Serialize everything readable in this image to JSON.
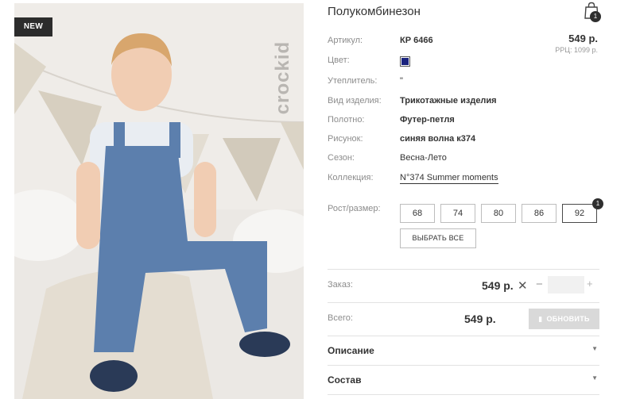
{
  "product": {
    "badge": "NEW",
    "brand_watermark": "crockid",
    "title": "Полукомбинезон",
    "cart_count": "1",
    "price": "549 р.",
    "rrp": "РРЦ: 1099 р.",
    "color_hex": "#1a237e",
    "attributes": [
      {
        "label": "Артикул:",
        "value": "КР 6466"
      },
      {
        "label": "Цвет:",
        "value": ""
      },
      {
        "label": "Утеплитель:",
        "value": "\""
      },
      {
        "label": "Вид изделия:",
        "value": "Трикотажные изделия"
      },
      {
        "label": "Полотно:",
        "value": "Футер-петля"
      },
      {
        "label": "Рисунок:",
        "value": "синяя волна к374"
      },
      {
        "label": "Сезон:",
        "value": "Весна-Лето"
      },
      {
        "label": "Коллекция:",
        "value": "N°374 Summer moments"
      }
    ]
  },
  "sizes": {
    "label": "Рост/размер:",
    "options": [
      "68",
      "74",
      "80",
      "86",
      "92"
    ],
    "selected": "92",
    "selected_count": "1",
    "select_all": "ВЫБРАТЬ ВСЕ"
  },
  "order": {
    "label": "Заказ:",
    "price": "549 р.",
    "remove": "✕",
    "minus": "−",
    "plus": "+",
    "quantity": ""
  },
  "total": {
    "label": "Всего:",
    "price": "549 р.",
    "update_button": "ОБНОВИТЬ"
  },
  "sections": [
    {
      "title": "Описание"
    },
    {
      "title": "Состав"
    }
  ]
}
